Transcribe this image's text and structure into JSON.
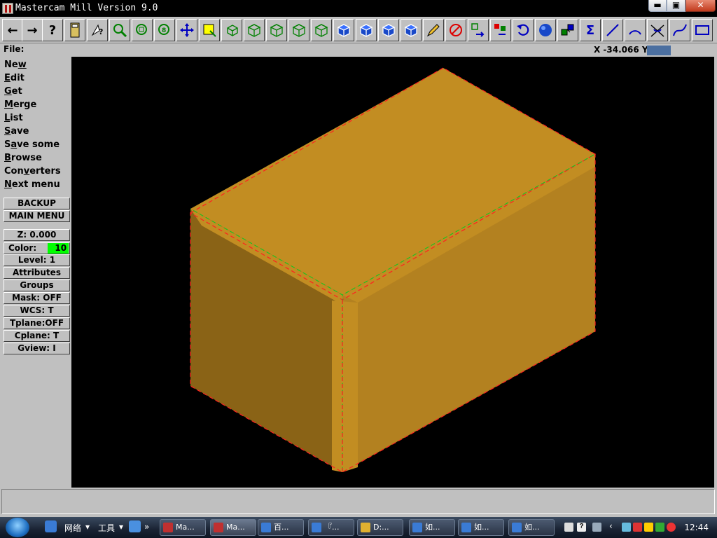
{
  "window": {
    "title": "Mastercam Mill Version 9.0",
    "buttons": {
      "minimize": "▬",
      "maximize": "▣",
      "close": "✕"
    }
  },
  "toolbar": {
    "buttons": [
      {
        "name": "back-arrow-icon",
        "glyph": "←"
      },
      {
        "name": "forward-arrow-icon",
        "glyph": "→"
      },
      {
        "name": "help-icon",
        "glyph": "?"
      },
      {
        "name": "calculator-icon",
        "glyph": ""
      },
      {
        "name": "analyze-icon",
        "glyph": ""
      },
      {
        "name": "zoom-window-icon",
        "glyph": ""
      },
      {
        "name": "unzoom-icon",
        "glyph": ""
      },
      {
        "name": "zoom-fit-icon",
        "glyph": ""
      },
      {
        "name": "pan-icon",
        "glyph": ""
      },
      {
        "name": "select-window-icon",
        "glyph": ""
      },
      {
        "name": "dynamic-rotate-icon",
        "glyph": ""
      },
      {
        "name": "wireframe-view-icon",
        "glyph": ""
      },
      {
        "name": "wireframe-front-icon",
        "glyph": ""
      },
      {
        "name": "wireframe-side-icon",
        "glyph": ""
      },
      {
        "name": "wireframe-iso-icon",
        "glyph": ""
      },
      {
        "name": "solid-top-icon",
        "glyph": ""
      },
      {
        "name": "solid-front-icon",
        "glyph": ""
      },
      {
        "name": "solid-side-icon",
        "glyph": ""
      },
      {
        "name": "solid-iso-icon",
        "glyph": ""
      },
      {
        "name": "pencil-icon",
        "glyph": ""
      },
      {
        "name": "no-draw-icon",
        "glyph": ""
      },
      {
        "name": "transform-icon",
        "glyph": ""
      },
      {
        "name": "transform-copy-icon",
        "glyph": ""
      },
      {
        "name": "undo-icon",
        "glyph": ""
      },
      {
        "name": "shade-sphere-icon",
        "glyph": ""
      },
      {
        "name": "layers-icon",
        "glyph": ""
      },
      {
        "name": "sigma-icon",
        "glyph": "Σ"
      },
      {
        "name": "line-icon",
        "glyph": ""
      },
      {
        "name": "arc-icon",
        "glyph": ""
      },
      {
        "name": "fillet-icon",
        "glyph": ""
      },
      {
        "name": "spline-icon",
        "glyph": ""
      },
      {
        "name": "rectangle-icon",
        "glyph": ""
      }
    ]
  },
  "info": {
    "prompt": "File:",
    "coords": "X -34.066  Y"
  },
  "menu": {
    "items": [
      {
        "label": "New",
        "key": "w"
      },
      {
        "label": "Edit",
        "key": "E"
      },
      {
        "label": "Get",
        "key": "G"
      },
      {
        "label": "Merge",
        "key": "M"
      },
      {
        "label": "List",
        "key": "L"
      },
      {
        "label": "Save",
        "key": "S"
      },
      {
        "label": "Save some",
        "key": "a"
      },
      {
        "label": "Browse",
        "key": "B"
      },
      {
        "label": "Converters",
        "key": "v"
      },
      {
        "label": "Next menu",
        "key": "N"
      }
    ],
    "backup": "BACKUP",
    "main_menu": "MAIN MENU",
    "z": "Z:   0.000",
    "color_label": "Color:",
    "color_value": "10",
    "level": "Level:  1",
    "attributes": "Attributes",
    "groups": "Groups",
    "mask": "Mask:  OFF",
    "wcs": "WCS:   T",
    "tplane": "Tplane:OFF",
    "cplane": "Cplane:  T",
    "gview": "Gview:   I"
  },
  "colors": {
    "viewport_bg": "#000000",
    "solid_top": "#c28d22",
    "solid_left": "#8a6316",
    "solid_right": "#b38120",
    "edge_red": "#ff2020",
    "edge_green": "#20c020",
    "color_swatch": "#00ff00"
  },
  "taskbar": {
    "quick": [
      {
        "label": "网络"
      },
      {
        "label": "工具"
      }
    ],
    "tasks": [
      {
        "label": "Ma...",
        "color": "#c03030",
        "active": false
      },
      {
        "label": "Ma...",
        "color": "#c03030",
        "active": true
      },
      {
        "label": "百...",
        "color": "#3a7bd5",
        "active": false
      },
      {
        "label": "『...",
        "color": "#3a7bd5",
        "active": false
      },
      {
        "label": "D:...",
        "color": "#e0b030",
        "active": false
      },
      {
        "label": "如...",
        "color": "#3a7bd5",
        "active": false
      },
      {
        "label": "如...",
        "color": "#3a7bd5",
        "active": false
      },
      {
        "label": "如...",
        "color": "#3a7bd5",
        "active": false
      }
    ],
    "clock": "12:44"
  }
}
